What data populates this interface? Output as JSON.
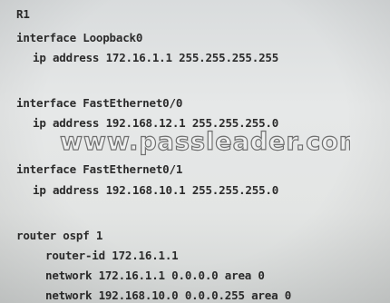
{
  "terminal": {
    "lines": [
      "R1",
      "interface Loopback0",
      "ip address 172.16.1.1 255.255.255.255",
      "interface FastEthernet0/0",
      "ip address 192.168.12.1 255.255.255.0",
      "interface FastEthernet0/1",
      "ip address 192.168.10.1 255.255.255.0",
      "router ospf 1",
      "router-id 172.16.1.1",
      "network 172.16.1.1 0.0.0.0 area 0",
      "network 192.168.10.0 0.0.0.255 area 0"
    ]
  },
  "watermark": {
    "text": "www.passleader.com"
  }
}
